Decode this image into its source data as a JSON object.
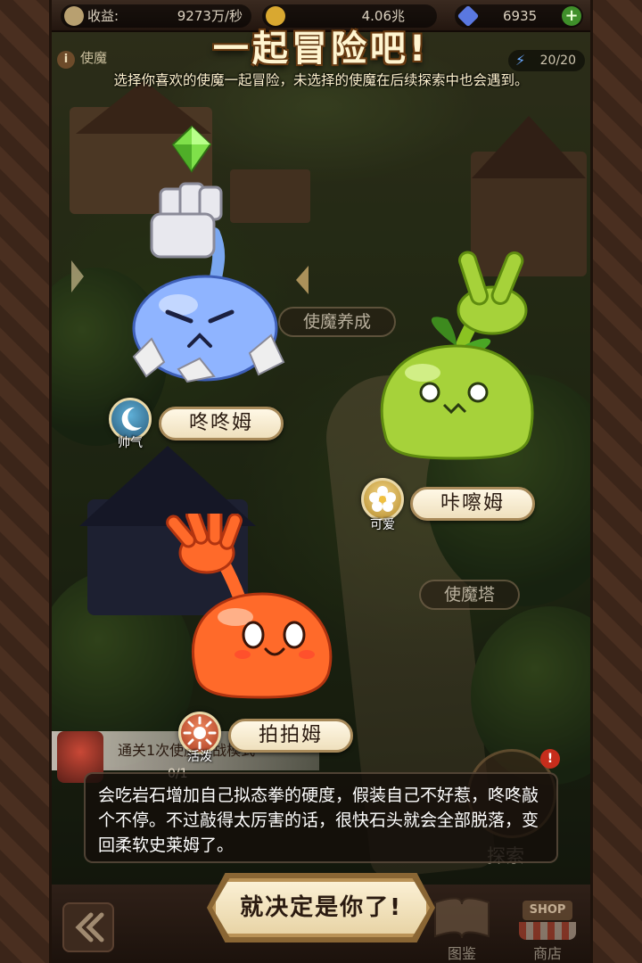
{
  "resources": {
    "income_label": "收益:",
    "income_value": "9273万/秒",
    "gold_value": "4.06兆",
    "gem_value": "6935"
  },
  "tab": {
    "label": "使魔",
    "energy": "20/20"
  },
  "overlay": {
    "title": "一起冒险吧!",
    "subtitle": "选择你喜欢的使魔一起冒险，未选择的使魔在后续探索中也会遇到。"
  },
  "scene_labels": {
    "training": "使魔养成",
    "tower": "使魔塔",
    "explore": "探索"
  },
  "quest": {
    "text": "通关1次使魔挑战模式",
    "progress": "0/1"
  },
  "familiars": [
    {
      "name": "咚咚姆",
      "trait": "帅气",
      "color": "#8fb4ff",
      "selected": true
    },
    {
      "name": "咔嚓姆",
      "trait": "可爱",
      "color": "#a6d23a",
      "selected": false
    },
    {
      "name": "拍拍姆",
      "trait": "活泼",
      "color": "#ff6a2a",
      "selected": false
    }
  ],
  "description": "会吃岩石增加自己拟态拳的硬度，假装自己不好惹，咚咚敲个不停。不过敲得太厉害的话，很快石头就会全部脱落，变回柔软史莱姆了。",
  "confirm_button": "就决定是你了!",
  "bottom_nav": {
    "codex": "图鉴",
    "shop": "商店",
    "shop_sign": "SHOP"
  },
  "badge": "!"
}
